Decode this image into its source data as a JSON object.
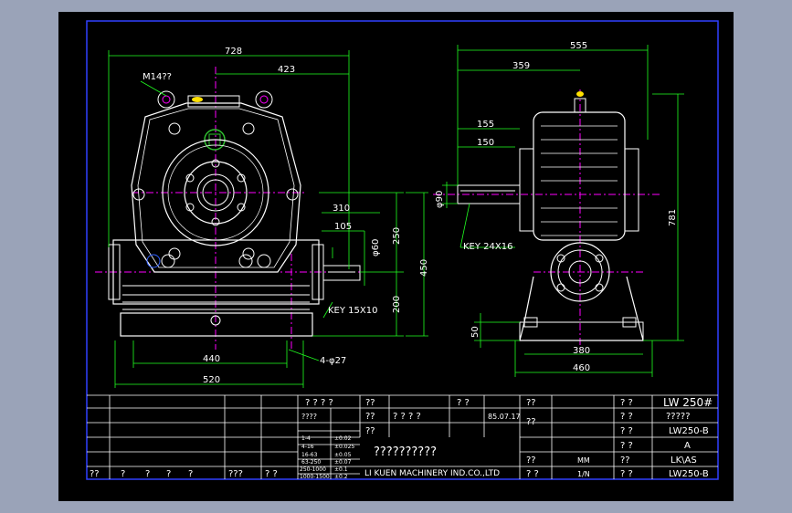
{
  "drawing": {
    "front_view": {
      "dim_728": "728",
      "dim_423": "423",
      "thread": "M14??",
      "dim_310": "310",
      "dim_105": "105",
      "dim_250": "250",
      "dim_phi60": "φ60",
      "dim_450": "450",
      "dim_200": "200",
      "key": "KEY 15X10",
      "dim_440": "440",
      "dim_520": "520",
      "holes": "4-φ27"
    },
    "side_view": {
      "dim_555": "555",
      "dim_359": "359",
      "dim_155": "155",
      "dim_150": "150",
      "dim_phi90": "φ90",
      "key": "KEY 24X16",
      "dim_781": "781",
      "dim_50": "50",
      "dim_380": "380",
      "dim_460": "460"
    },
    "title_block": {
      "model": "LW 250#",
      "row1_labels": [
        "? ? ? ?",
        "??",
        "? ?",
        "??",
        "? ?"
      ],
      "row2_a": "????",
      "row2_b": "?????",
      "date": "85.07.17",
      "sign_marks": "? ?  ? ?",
      "tol_rows": [
        [
          "1-4",
          "±0.02"
        ],
        [
          "4-16",
          "±0.025"
        ],
        [
          "16-63",
          "±0.05"
        ],
        [
          "63-250",
          "±0.07"
        ],
        [
          "250-1000",
          "±0.1"
        ],
        [
          "1000-1500",
          "±0.2"
        ]
      ],
      "drawing_no_1": "LW250-B",
      "rev": "A",
      "material": "LK\\AS",
      "drawing_no_2": "LW250-B",
      "unit": "MM",
      "scale": "1/N",
      "name_placeholder": "??????????",
      "company": "LI KUEN MACHINERY IND.CO.,LTD",
      "bottom_left": [
        "??",
        "?",
        "?",
        "?",
        "?",
        "???",
        "? ?"
      ],
      "right_col_labels": [
        "? ?",
        "? ?",
        "? ?",
        "??",
        "??",
        "? ?"
      ],
      "mid_labels": [
        "??",
        "??",
        "??"
      ]
    }
  }
}
